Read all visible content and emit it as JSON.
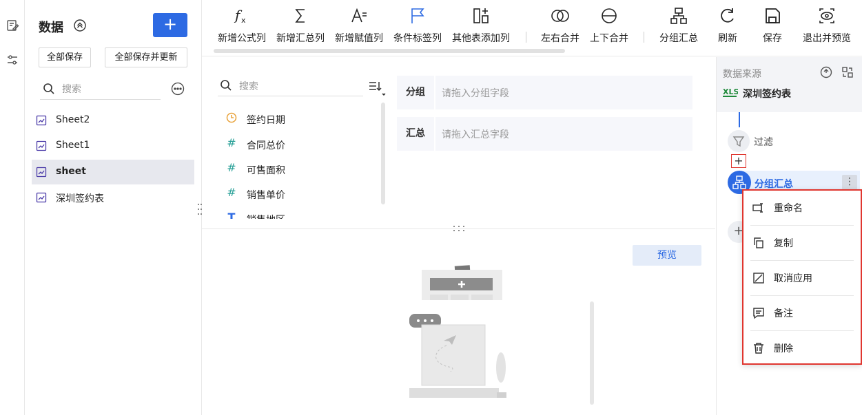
{
  "strip": {
    "icons": [
      "edit-sheet-icon",
      "settings-icon"
    ]
  },
  "data_panel": {
    "title": "数据",
    "save_all": "全部保存",
    "save_all_update": "全部保存并更新",
    "search_placeholder": "搜索",
    "sheets": [
      {
        "label": "Sheet2",
        "active": false
      },
      {
        "label": "Sheet1",
        "active": false
      },
      {
        "label": "sheet",
        "active": true
      },
      {
        "label": "深圳签约表",
        "active": false
      }
    ]
  },
  "toolbar": {
    "items": [
      {
        "label": "新增公式列",
        "icon": "fx-icon"
      },
      {
        "label": "新增汇总列",
        "icon": "sigma-icon"
      },
      {
        "label": "新增赋值列",
        "icon": "assign-icon"
      },
      {
        "label": "条件标签列",
        "icon": "flag-icon"
      },
      {
        "label": "其他表添加列",
        "icon": "add-column-icon"
      },
      {
        "label": "左右合并",
        "icon": "merge-horizontal-icon"
      },
      {
        "label": "上下合并",
        "icon": "merge-vertical-icon"
      },
      {
        "label": "分组汇总",
        "icon": "group-summary-icon"
      },
      {
        "label": "刷新",
        "icon": "refresh-icon"
      },
      {
        "label": "保存",
        "icon": "save-icon"
      },
      {
        "label": "退出并预览",
        "icon": "preview-exit-icon"
      }
    ]
  },
  "fields": {
    "search_placeholder": "搜索",
    "items": [
      {
        "label": "签约日期",
        "type": "date"
      },
      {
        "label": "合同总价",
        "type": "number"
      },
      {
        "label": "可售面积",
        "type": "number"
      },
      {
        "label": "销售单价",
        "type": "number"
      },
      {
        "label": "销售地区",
        "type": "text"
      }
    ]
  },
  "drop_zones": {
    "group_label": "分组",
    "group_placeholder": "请拖入分组字段",
    "summary_label": "汇总",
    "summary_placeholder": "请拖入汇总字段"
  },
  "preview": {
    "button": "预览"
  },
  "flow": {
    "title": "数据来源",
    "source": "深圳签约表",
    "filter": "过滤",
    "add": "+",
    "group": "分组汇总",
    "menu": [
      {
        "label": "重命名",
        "icon": "rename-icon"
      },
      {
        "label": "复制",
        "icon": "copy-icon"
      },
      {
        "label": "取消应用",
        "icon": "cancel-apply-icon"
      },
      {
        "label": "备注",
        "icon": "comment-icon"
      },
      {
        "label": "删除",
        "icon": "delete-icon"
      }
    ]
  },
  "colors": {
    "accent": "#2d6ae3",
    "highlight_border": "#e0362f",
    "number_icon": "#2aa198",
    "date_icon": "#e8a23a",
    "text_icon": "#2d6ae3"
  }
}
